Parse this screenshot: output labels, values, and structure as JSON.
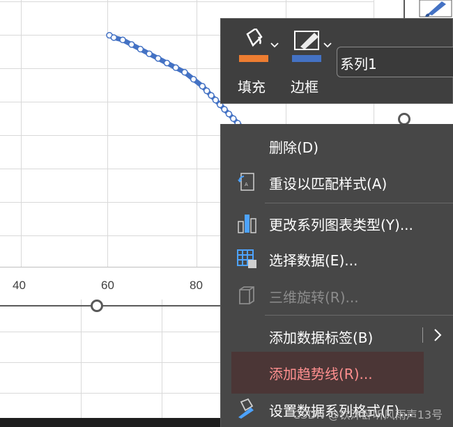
{
  "chart": {
    "x_tick_labels": [
      "40",
      "60",
      "80"
    ]
  },
  "chart_data": {
    "type": "scatter",
    "series": [
      {
        "name": "系列1",
        "x": [
          60,
          61,
          63,
          65,
          67,
          69,
          71,
          73,
          75,
          77,
          79,
          81,
          82,
          83,
          84,
          85,
          86,
          87,
          88,
          89,
          90
        ],
        "y": [
          10.0,
          9.9,
          9.8,
          9.6,
          9.4,
          9.2,
          9.0,
          8.8,
          8.6,
          8.4,
          8.1,
          7.8,
          7.6,
          7.4,
          7.2,
          7.0,
          6.8,
          6.6,
          6.4,
          6.2,
          6.0
        ]
      }
    ],
    "xlim": [
      40,
      90
    ],
    "ylim": [
      0,
      10.5
    ],
    "grid": true
  },
  "mini_toolbar": {
    "fill_label": "填充",
    "border_label": "边框",
    "series_value": "系列1",
    "colors": {
      "fill": "#ed7d31",
      "border": "#4472c4"
    }
  },
  "context_menu": {
    "items": [
      {
        "label": "删除(D)",
        "icon": "none",
        "enabled": true
      },
      {
        "label": "重设以匹配样式(A)",
        "icon": "reset-style-icon",
        "enabled": true
      },
      {
        "label": "更改系列图表类型(Y)...",
        "icon": "change-chart-type-icon",
        "enabled": true
      },
      {
        "label": "选择数据(E)...",
        "icon": "select-data-icon",
        "enabled": true
      },
      {
        "label": "三维旋转(R)...",
        "icon": "3d-rotate-icon",
        "enabled": false
      },
      {
        "label": "添加数据标签(B)",
        "icon": "none",
        "enabled": true,
        "has_submenu": true
      },
      {
        "label": "添加趋势线(R)...",
        "icon": "none",
        "enabled": true,
        "highlighted": true
      },
      {
        "label": "设置数据系列格式(F)...",
        "icon": "format-series-icon",
        "enabled": true
      }
    ],
    "colors": {
      "highlight_text": "#ff8f8f",
      "menu_bg": "#474747"
    }
  },
  "watermark": "CSDN @钦沐卧听风雨声13号"
}
